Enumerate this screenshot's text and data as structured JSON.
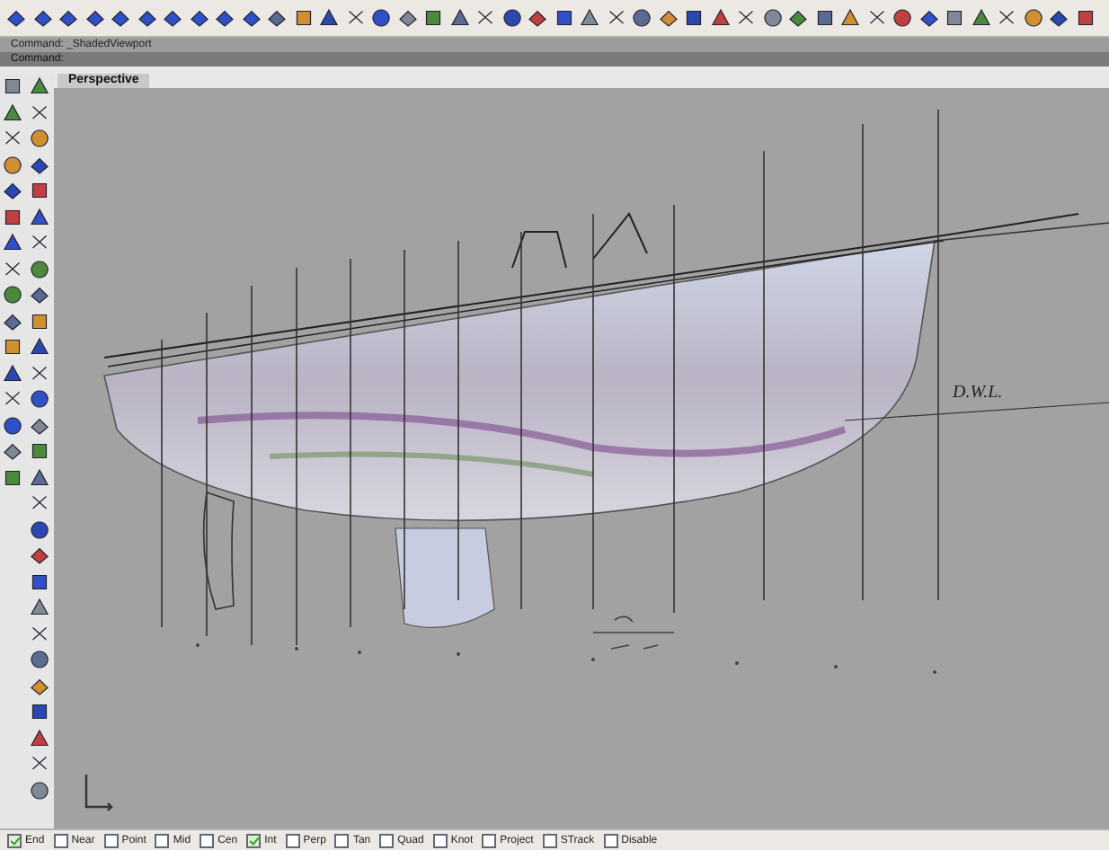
{
  "command_history": "Command: _ShadedViewport",
  "command_prompt": "Command:",
  "viewport": {
    "title": "Perspective",
    "annotation": "D.W.L."
  },
  "osnaps": [
    {
      "label": "End",
      "checked": true
    },
    {
      "label": "Near",
      "checked": false
    },
    {
      "label": "Point",
      "checked": false
    },
    {
      "label": "Mid",
      "checked": false
    },
    {
      "label": "Cen",
      "checked": false
    },
    {
      "label": "Int",
      "checked": true
    },
    {
      "label": "Perp",
      "checked": false
    },
    {
      "label": "Tan",
      "checked": false
    },
    {
      "label": "Quad",
      "checked": false
    },
    {
      "label": "Knot",
      "checked": false
    },
    {
      "label": "Project",
      "checked": false
    },
    {
      "label": "STrack",
      "checked": false
    },
    {
      "label": "Disable",
      "checked": false
    }
  ]
}
